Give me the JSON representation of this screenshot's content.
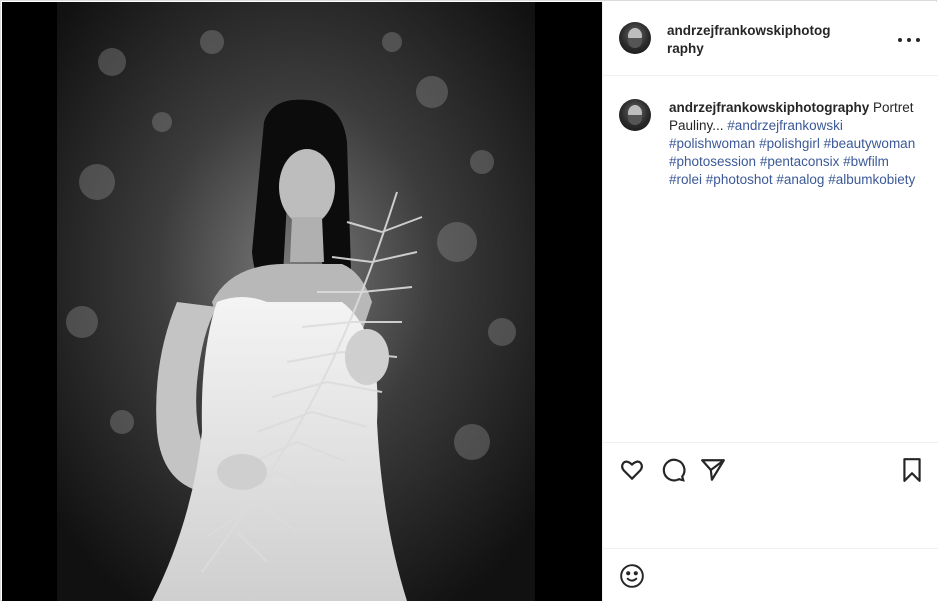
{
  "post": {
    "author": "andrzejfrankowskiphotography",
    "caption_text": "Portret Pauliny...",
    "hashtags": [
      "#andrzejfrankowski",
      "#polishwoman",
      "#polishgirl",
      "#beautywoman",
      "#photosession",
      "#pentaconsix",
      "#bwfilm",
      "#rolei",
      "#photoshot",
      "#analog",
      "#albumkobiety"
    ]
  },
  "header": {
    "username_line1": "andrzejfrankowskiphotog",
    "username_line2": "raphy"
  },
  "icons": {
    "more": "more-options-icon",
    "like": "heart-icon",
    "comment": "comment-icon",
    "share": "paper-plane-icon",
    "save": "bookmark-icon",
    "emoji": "smiley-icon"
  },
  "colors": {
    "text": "#262626",
    "hashtag": "#3b5998",
    "border": "#efefef"
  }
}
